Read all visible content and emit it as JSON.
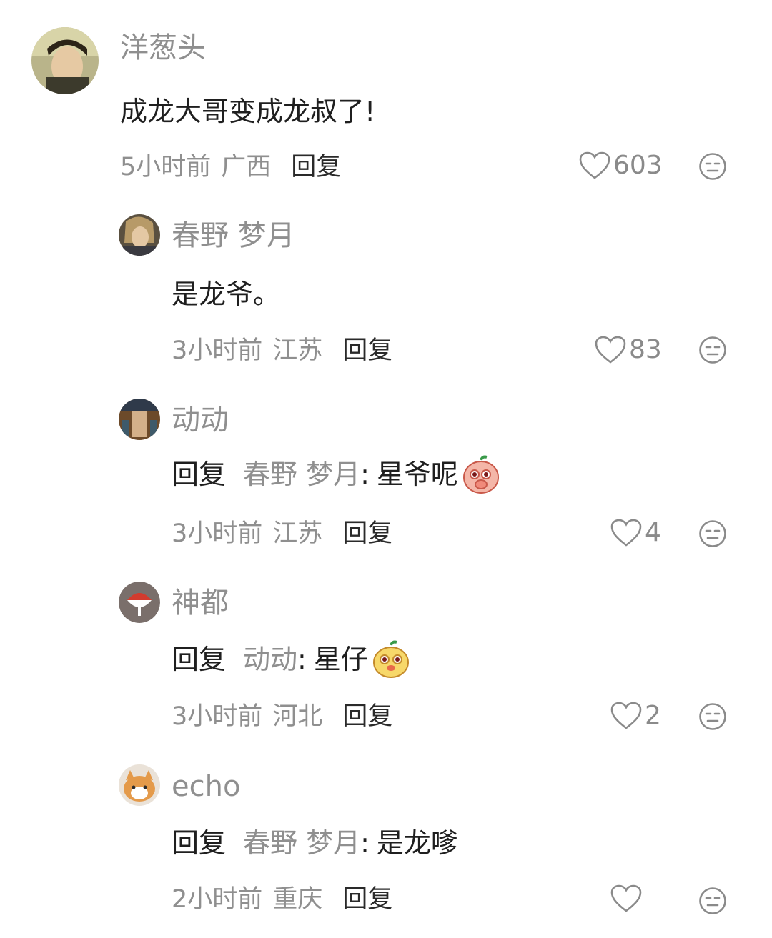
{
  "comments": [
    {
      "username": "洋葱头",
      "text": "成龙大哥变成龙叔了!",
      "time": "5小时前",
      "location": "广西",
      "reply_label": "回复",
      "likes": "603"
    },
    {
      "username": "春野 梦月",
      "text": "是龙爷。",
      "time": "3小时前",
      "location": "江苏",
      "reply_label": "回复",
      "likes": "83"
    },
    {
      "username": "动动",
      "reply_prefix": "回复",
      "reply_to": "春野 梦月",
      "colon": ":",
      "text": "星爷呢",
      "emoji": "peach-covering-mouth-emoji",
      "time": "3小时前",
      "location": "江苏",
      "reply_label": "回复",
      "likes": "4"
    },
    {
      "username": "神都",
      "reply_prefix": "回复",
      "reply_to": "动动",
      "colon": ":",
      "text": "星仔",
      "emoji": "yellow-dog-face-emoji",
      "time": "3小时前",
      "location": "河北",
      "reply_label": "回复",
      "likes": "2"
    },
    {
      "username": "echo",
      "reply_prefix": "回复",
      "reply_to": "春野 梦月",
      "colon": ":",
      "text": "是龙嗲",
      "time": "2小时前",
      "location": "重庆",
      "reply_label": "回复",
      "likes": ""
    }
  ],
  "icons": {
    "like": "heart-outline-icon",
    "dislike": "meh-face-icon"
  },
  "colors": {
    "primary_text": "#1f1f1f",
    "secondary_text": "#8f8f8f",
    "icon_gray": "#8a8a8a"
  }
}
